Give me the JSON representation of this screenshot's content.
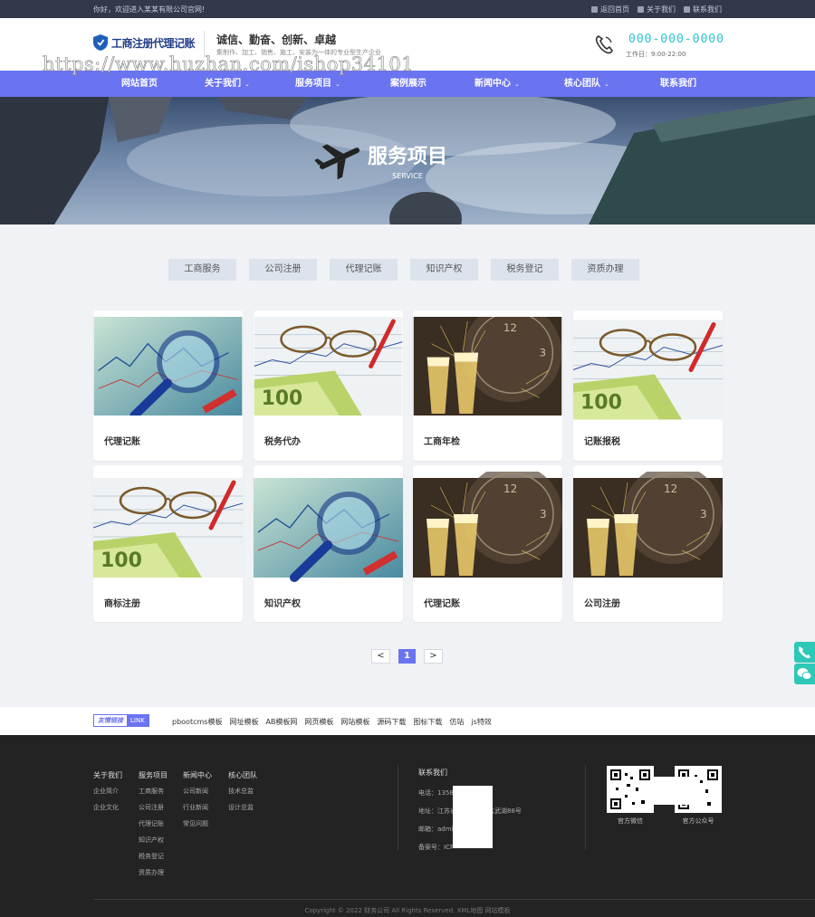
{
  "topbar": {
    "welcome": "你好，欢迎进入某某有限公司官网!",
    "links": [
      {
        "label": "返回首页",
        "icon": "home-icon"
      },
      {
        "label": "关于我们",
        "icon": "document-icon"
      },
      {
        "label": "联系我们",
        "icon": "phone-icon"
      }
    ]
  },
  "header": {
    "logo_text": "工商注册代理记账",
    "slogan": "诚信、勤奋、创新、卓越",
    "slogan_sub": "集制作、加工、销售、施工、安装为一体的专业型生产企业",
    "phone": "000-000-0000",
    "worktime": "工作日：9:00-22:00",
    "watermark": "https://www.huzhan.com/ishop34101"
  },
  "nav": {
    "items": [
      {
        "label": "网站首页",
        "caret": false
      },
      {
        "label": "关于我们",
        "caret": true
      },
      {
        "label": "服务项目",
        "caret": true
      },
      {
        "label": "案例展示",
        "caret": false
      },
      {
        "label": "新闻中心",
        "caret": true
      },
      {
        "label": "核心团队",
        "caret": true
      },
      {
        "label": "联系我们",
        "caret": false
      }
    ]
  },
  "banner": {
    "title": "服务项目",
    "subtitle": "SERVICE"
  },
  "tabs": [
    "工商服务",
    "公司注册",
    "代理记账",
    "知识产权",
    "税务登记",
    "资质办理"
  ],
  "cards": [
    {
      "title": "代理记账",
      "image": "magnifier"
    },
    {
      "title": "税务代办",
      "image": "glasses"
    },
    {
      "title": "工商年检",
      "image": "champagne"
    },
    {
      "title": "记账报税",
      "image": "glasses"
    },
    {
      "title": "商标注册",
      "image": "glasses"
    },
    {
      "title": "知识产权",
      "image": "magnifier"
    },
    {
      "title": "代理记账",
      "image": "champagne"
    },
    {
      "title": "公司注册",
      "image": "champagne"
    }
  ],
  "pagination": {
    "prev": "<",
    "current": "1",
    "next": ">"
  },
  "friend_links": {
    "badge_a": "友情链接",
    "badge_b": "LINK",
    "links": [
      "pbootcms模板",
      "网址模板",
      "AB模板网",
      "网页模板",
      "网站模板",
      "源码下载",
      "图标下载",
      "仿站",
      "js特效"
    ]
  },
  "footer": {
    "columns": [
      {
        "head": "关于我们",
        "items": [
          "企业简介",
          "企业文化"
        ]
      },
      {
        "head": "服务项目",
        "items": [
          "工商服务",
          "公司注册",
          "代理记账",
          "知识产权",
          "税务登记",
          "资质办理"
        ]
      },
      {
        "head": "新闻中心",
        "items": [
          "公司新闻",
          "行业新闻",
          "常见问题"
        ]
      },
      {
        "head": "核心团队",
        "items": [
          "技术总监",
          "设计总监"
        ]
      }
    ],
    "contact": {
      "head": "联系我们",
      "lines": [
        "电话：1358",
        "地址：江苏省　　　　　玄武湖88号",
        "邮箱：admi　　　　　m",
        "备案号：ICP"
      ]
    },
    "qrs": [
      "官方微信",
      "官方公众号"
    ],
    "copyright": "Copyright © 2022 财务公司 All Rights Reserved. XML地图 网站模板"
  }
}
